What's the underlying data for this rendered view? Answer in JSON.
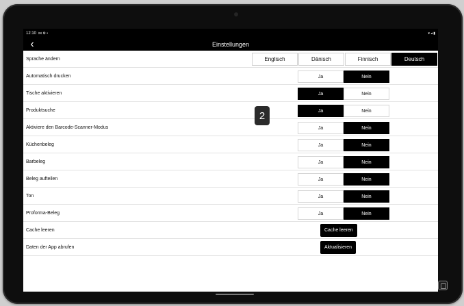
{
  "statusbar": {
    "time": "12:10",
    "left_icons": "⋈ ⚙ •",
    "right_icons": "▾ ◂ ▮"
  },
  "header": {
    "back_icon": "chevron-left-icon",
    "title": "Einstellungen"
  },
  "language_row": {
    "label": "Sprache ändern",
    "options": [
      "Englisch",
      "Dänisch",
      "Finnisch",
      "Deutsch"
    ],
    "selected": "Deutsch"
  },
  "toggle_rows": [
    {
      "label": "Automatisch drucken",
      "yes": "Ja",
      "no": "Nein",
      "selected": "no"
    },
    {
      "label": "Tische aktivieren",
      "yes": "Ja",
      "no": "Nein",
      "selected": "yes"
    },
    {
      "label": "Produktsuche",
      "yes": "Ja",
      "no": "Nein",
      "selected": "yes"
    },
    {
      "label": "Aktiviere den Barcode-Scanner-Modus",
      "yes": "Ja",
      "no": "Nein",
      "selected": "no"
    },
    {
      "label": "Küchenbeleg",
      "yes": "Ja",
      "no": "Nein",
      "selected": "no"
    },
    {
      "label": "Barbeleg",
      "yes": "Ja",
      "no": "Nein",
      "selected": "no"
    },
    {
      "label": "Beleg aufteilen",
      "yes": "Ja",
      "no": "Nein",
      "selected": "no"
    },
    {
      "label": "Ton",
      "yes": "Ja",
      "no": "Nein",
      "selected": "no"
    },
    {
      "label": "Proforma-Beleg",
      "yes": "Ja",
      "no": "Nein",
      "selected": "no"
    }
  ],
  "action_rows": [
    {
      "label": "Cache leeren",
      "button": "Cache leeren"
    },
    {
      "label": "Daten der App abrufen",
      "button": "Aktualisieren"
    }
  ],
  "marker": "2",
  "colors": {
    "active_bg": "#000000",
    "inactive_bg": "#ffffff",
    "device_frame": "#0e0e0e"
  }
}
